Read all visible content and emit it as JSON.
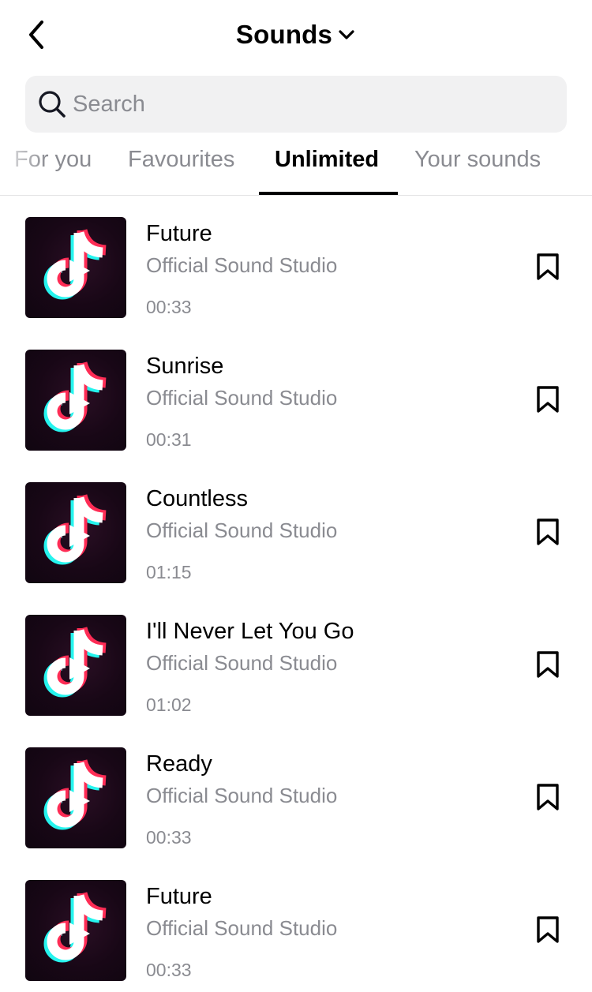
{
  "header": {
    "back_icon": "chevron-left-icon",
    "title": "Sounds",
    "title_dropdown_icon": "chevron-down-icon"
  },
  "search": {
    "placeholder": "Search",
    "value": "",
    "icon": "search-icon"
  },
  "tabs": [
    {
      "label": "For you",
      "active": false
    },
    {
      "label": "Favourites",
      "active": false
    },
    {
      "label": "Unlimited",
      "active": true
    },
    {
      "label": "Your sounds",
      "active": false
    }
  ],
  "sounds": [
    {
      "title": "Future",
      "artist": "Official Sound Studio",
      "duration": "00:33"
    },
    {
      "title": "Sunrise",
      "artist": "Official Sound Studio",
      "duration": "00:31"
    },
    {
      "title": "Countless",
      "artist": "Official Sound Studio",
      "duration": "01:15"
    },
    {
      "title": "I'll Never Let You Go",
      "artist": "Official Sound Studio",
      "duration": "01:02"
    },
    {
      "title": "Ready",
      "artist": "Official Sound Studio",
      "duration": "00:33"
    },
    {
      "title": "Future",
      "artist": "Official Sound Studio",
      "duration": "00:33"
    }
  ],
  "colors": {
    "accent_cyan": "#25F4EE",
    "accent_red": "#FE2C55",
    "secondary_text": "#8a8b91",
    "search_bg": "#f1f1f2"
  },
  "icons": {
    "thumbnail": "tiktok-logo-icon",
    "save": "bookmark-icon"
  }
}
